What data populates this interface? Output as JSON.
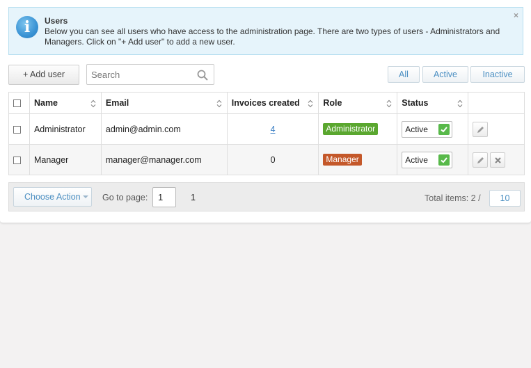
{
  "info": {
    "title": "Users",
    "text": "Below you can see all users who have access to the administration page. There are two types of users - Administrators and Managers. Click on \"+ Add user\" to add a new user.",
    "close_glyph": "×"
  },
  "toolbar": {
    "add_user_label": "+ Add user",
    "search_placeholder": "Search",
    "search_value": "",
    "filters": {
      "all": "All",
      "active": "Active",
      "inactive": "Inactive"
    }
  },
  "table": {
    "headers": {
      "name": "Name",
      "email": "Email",
      "invoices": "Invoices created",
      "role": "Role",
      "status": "Status"
    },
    "rows": [
      {
        "name": "Administrator",
        "email": "admin@admin.com",
        "invoices": "4",
        "role": "Administrator",
        "status": "Active"
      },
      {
        "name": "Manager",
        "email": "manager@manager.com",
        "invoices": "0",
        "role": "Manager",
        "status": "Active"
      }
    ]
  },
  "footer": {
    "choose_action": "Choose Action",
    "goto_label": "Go to page:",
    "page_value": "1",
    "page_total": "1",
    "total_label": "Total items: 2 /",
    "per_page": "10"
  },
  "colors": {
    "role_administrator": "#5aa72f",
    "role_manager": "#c4582a",
    "status_active": "#58b94a",
    "accent_blue": "#4b8fc2",
    "info_bg": "#e6f4fb"
  },
  "icons": [
    "info-icon",
    "close-icon",
    "search-icon",
    "sort-icon",
    "check-icon",
    "pencil-icon",
    "delete-icon",
    "caret-down-icon"
  ]
}
